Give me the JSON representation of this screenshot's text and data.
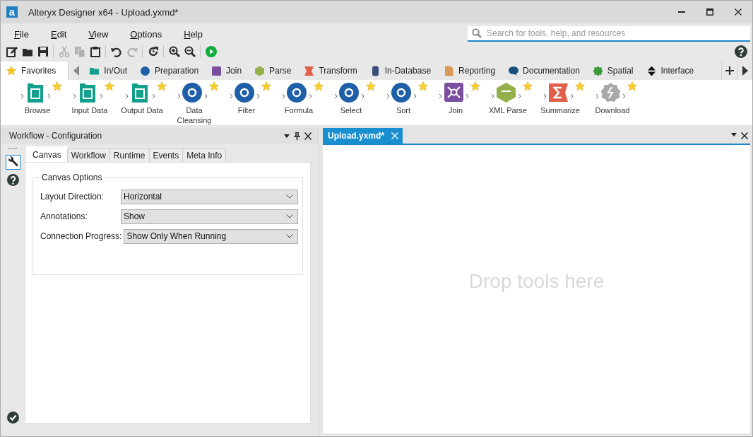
{
  "window": {
    "logo_text": "a",
    "title": "Alteryx Designer x64 - Upload.yxmd*"
  },
  "menu": [
    {
      "label": "File"
    },
    {
      "label": "Edit"
    },
    {
      "label": "View"
    },
    {
      "label": "Options"
    },
    {
      "label": "Help"
    }
  ],
  "search": {
    "placeholder": "Search for tools, help, and resources"
  },
  "toolbar": [
    {
      "kind": "new",
      "disabled": false
    },
    {
      "kind": "open",
      "disabled": false
    },
    {
      "kind": "save",
      "disabled": false
    },
    {
      "kind": "sep"
    },
    {
      "kind": "cut",
      "disabled": true
    },
    {
      "kind": "copy",
      "disabled": true
    },
    {
      "kind": "paste",
      "disabled": false
    },
    {
      "kind": "sep"
    },
    {
      "kind": "undo",
      "disabled": false
    },
    {
      "kind": "redo",
      "disabled": true
    },
    {
      "kind": "sep"
    },
    {
      "kind": "refresh",
      "disabled": false
    },
    {
      "kind": "sep"
    },
    {
      "kind": "zoomin",
      "disabled": false
    },
    {
      "kind": "zoomout",
      "disabled": false
    },
    {
      "kind": "sep"
    },
    {
      "kind": "run",
      "disabled": false
    }
  ],
  "category_tabs": [
    {
      "label": "Favorites",
      "kind": "star",
      "color": "#f5c518",
      "selected": true
    },
    {
      "label": "In/Out",
      "kind": "folder",
      "color": "#12a08c",
      "selected": false
    },
    {
      "label": "Preparation",
      "kind": "circle",
      "color": "#1f5fa8",
      "selected": false
    },
    {
      "label": "Join",
      "kind": "square",
      "color": "#7b4fa0",
      "selected": false
    },
    {
      "label": "Parse",
      "kind": "hexagon",
      "color": "#93b04a",
      "selected": false
    },
    {
      "label": "Transform",
      "kind": "flag",
      "color": "#e0604a",
      "selected": false
    },
    {
      "label": "In-Database",
      "kind": "cylinder",
      "color": "#3d4f75",
      "selected": false
    },
    {
      "label": "Reporting",
      "kind": "document",
      "color": "#d99a55",
      "selected": false
    },
    {
      "label": "Documentation",
      "kind": "bubble",
      "color": "#174f7a",
      "selected": false
    },
    {
      "label": "Spatial",
      "kind": "blob",
      "color": "#3a9a3a",
      "selected": false
    },
    {
      "label": "Interface",
      "kind": "updown",
      "color": "#111111",
      "selected": false
    }
  ],
  "tools": [
    {
      "label": "Browse",
      "kind": "folder",
      "color": "#12a08c"
    },
    {
      "label": "Input Data",
      "kind": "folder",
      "color": "#12a08c"
    },
    {
      "label": "Output Data",
      "kind": "folder",
      "color": "#12a08c"
    },
    {
      "label": "Data Cleansing",
      "kind": "circle",
      "color": "#1f5fa8"
    },
    {
      "label": "Filter",
      "kind": "circle",
      "color": "#1f5fa8"
    },
    {
      "label": "Formula",
      "kind": "circle",
      "color": "#1f5fa8"
    },
    {
      "label": "Select",
      "kind": "circle",
      "color": "#1f5fa8"
    },
    {
      "label": "Sort",
      "kind": "circle",
      "color": "#1f5fa8"
    },
    {
      "label": "Join",
      "kind": "square",
      "color": "#7b4fa0"
    },
    {
      "label": "XML Parse",
      "kind": "hexagon",
      "color": "#93b04a"
    },
    {
      "label": "Summarize",
      "kind": "flag",
      "color": "#e0604a"
    },
    {
      "label": "Download",
      "kind": "blob",
      "color": "#a8a8a8"
    }
  ],
  "config_panel": {
    "title": "Workflow - Configuration",
    "side_icons": [
      {
        "kind": "wrench",
        "selected": true
      },
      {
        "kind": "help",
        "selected": false
      }
    ],
    "tabs": [
      {
        "label": "Canvas",
        "selected": true
      },
      {
        "label": "Workflow",
        "selected": false
      },
      {
        "label": "Runtime",
        "selected": false
      },
      {
        "label": "Events",
        "selected": false
      },
      {
        "label": "Meta Info",
        "selected": false
      }
    ],
    "group_title": "Canvas Options",
    "fields": [
      {
        "label": "Layout Direction:",
        "value": "Horizontal"
      },
      {
        "label": "Annotations:",
        "value": "Show"
      },
      {
        "label": "Connection Progress:",
        "value": "Show Only When Running"
      }
    ]
  },
  "document_tabs": [
    {
      "label": "Upload.yxmd*",
      "selected": true
    }
  ],
  "canvas": {
    "hint": "Drop tools here"
  }
}
